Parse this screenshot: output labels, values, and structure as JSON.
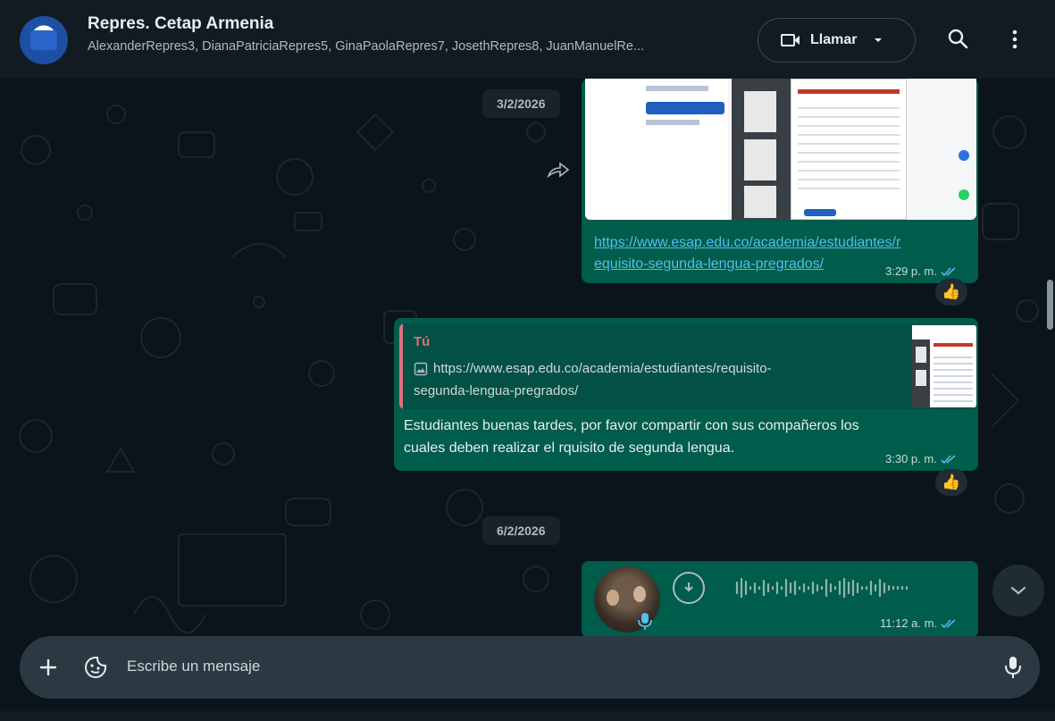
{
  "header": {
    "title": "Repres. Cetap Armenia",
    "members": "AlexanderRepres3, DianaPatriciaRepres5, GinaPaolaRepres7, JosethRepres8, JuanManuelRe...",
    "call_label": "Llamar"
  },
  "dates": {
    "first": "3/2/2026",
    "second": "6/2/2026"
  },
  "messages": {
    "m1": {
      "link": "https://www.esap.edu.co/academia/estudiantes/requisito-segunda-lengua-pregrados/",
      "link_line1": "https://www.esap.edu.co/academia/estudiantes/r",
      "link_line2": "equisito-segunda-lengua-pregrados/",
      "time": "3:29 p. m.",
      "reaction": "👍"
    },
    "m2": {
      "quote_author": "Tú",
      "quote_line1": "https://www.esap.edu.co/academia/estudiantes/requisito-",
      "quote_line2": "segunda-lengua-pregrados/",
      "text_line1": "Estudiantes buenas tardes, por favor compartir con sus compañeros los",
      "text_line2": "cuales deben realizar el rquisito de segunda lengua.",
      "time": "3:30 p. m.",
      "reaction": "👍"
    },
    "m3": {
      "time": "11:12 a. m."
    }
  },
  "composer": {
    "placeholder": "Escribe un mensaje"
  },
  "colors": {
    "outgoing_bubble": "#005c4b",
    "header_bg": "#111b21",
    "chat_bg": "#0b141a",
    "read_ticks": "#53bdeb",
    "quote_author": "#e26f7f"
  },
  "icons": [
    "video-icon",
    "chevron-down-icon",
    "search-icon",
    "menu-dots-icon",
    "forward-icon",
    "image-icon",
    "read-ticks-icon",
    "download-icon",
    "mic-icon",
    "plus-icon",
    "sticker-icon"
  ]
}
